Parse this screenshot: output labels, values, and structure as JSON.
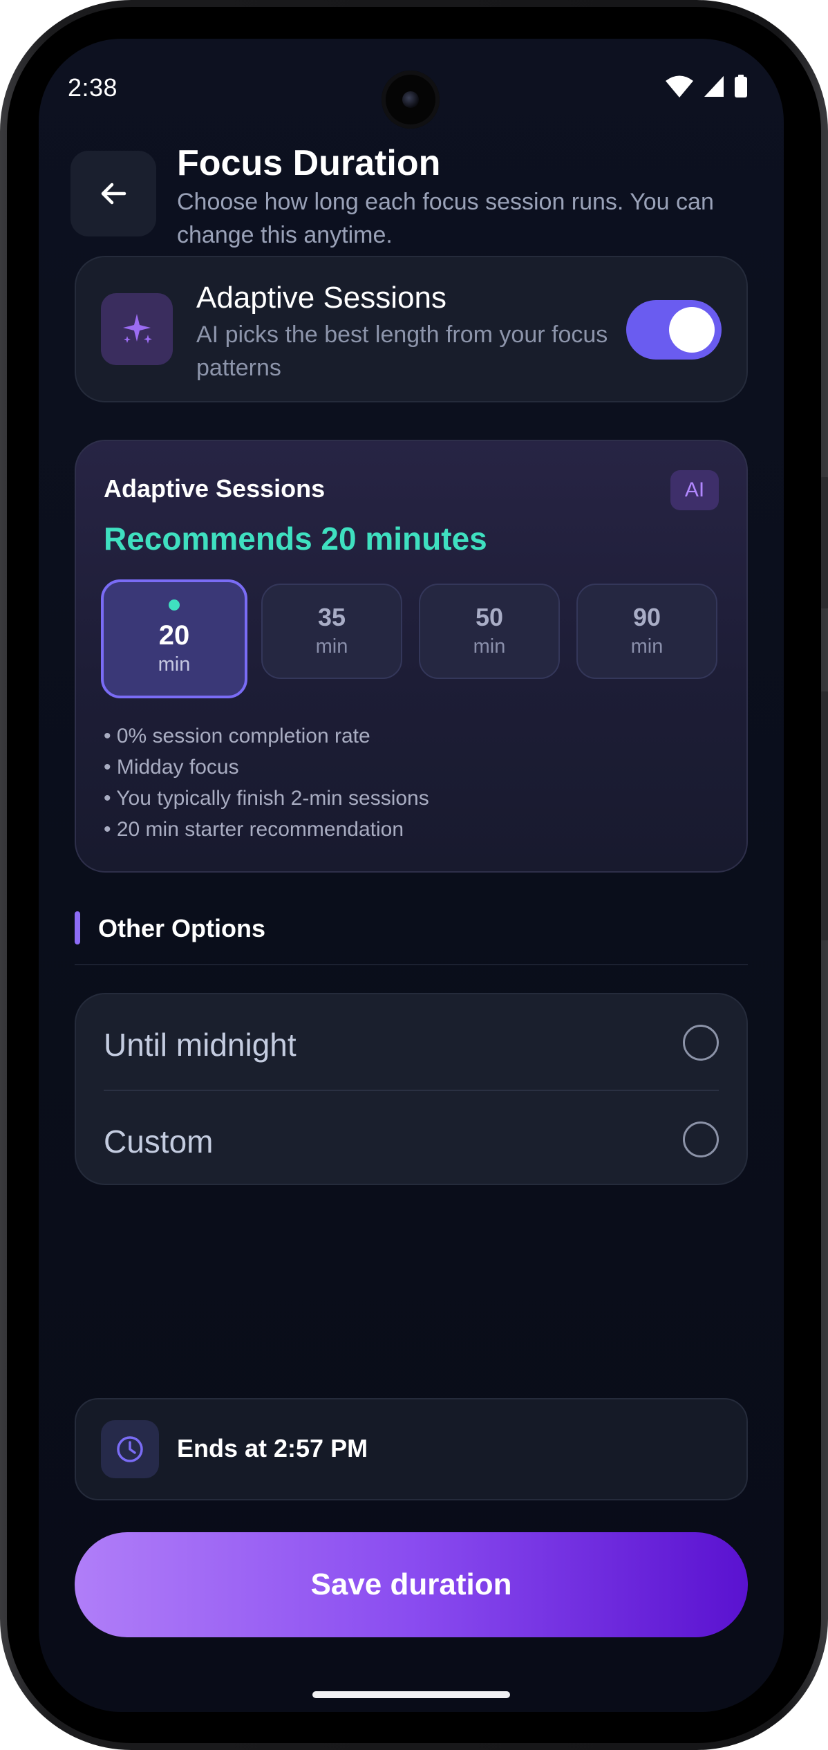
{
  "status_bar": {
    "time": "2:38",
    "icons": [
      "wifi-icon",
      "cellular-signal-icon",
      "battery-icon"
    ]
  },
  "header": {
    "back_icon": "arrow-left-icon",
    "title": "Focus Duration",
    "subtitle": "Choose how long each focus session runs. You can change this anytime."
  },
  "adaptive_toggle": {
    "icon": "sparkles-icon",
    "title": "Adaptive Sessions",
    "description": "AI picks the best length from your focus patterns",
    "enabled": true
  },
  "recommendation": {
    "title": "Adaptive Sessions",
    "badge": "AI",
    "headline": "Recommends 20 minutes",
    "options": [
      {
        "value": "20",
        "unit": "min",
        "selected": true
      },
      {
        "value": "35",
        "unit": "min",
        "selected": false
      },
      {
        "value": "50",
        "unit": "min",
        "selected": false
      },
      {
        "value": "90",
        "unit": "min",
        "selected": false
      }
    ],
    "reasons": [
      "• 0% session completion rate",
      "• Midday focus",
      "• You typically finish 2-min sessions",
      "• 20 min starter recommendation"
    ]
  },
  "other_options": {
    "title": "Other Options",
    "items": [
      {
        "label": "Until midnight",
        "selected": false
      },
      {
        "label": "Custom",
        "selected": false
      }
    ]
  },
  "summary": {
    "icon": "clock-icon",
    "text": "Ends at 2:57 PM"
  },
  "save_button": {
    "label": "Save duration"
  },
  "colors": {
    "accent_purple": "#6a5cf0",
    "accent_teal": "#3fe0c0",
    "background": "#0b0f1c"
  }
}
